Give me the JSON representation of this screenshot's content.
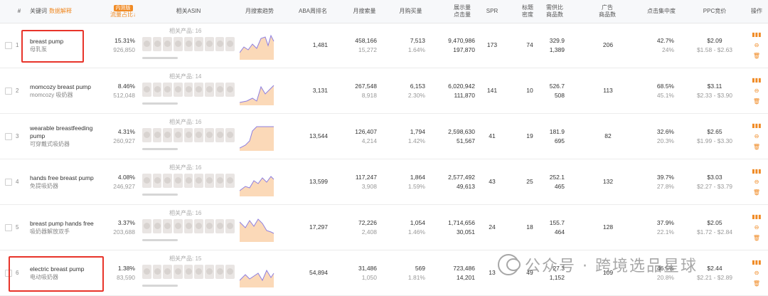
{
  "header": {
    "index": "#",
    "keyword": "关键词",
    "data_explain": "数据解释",
    "traffic_badge": "内测版",
    "traffic_share": "流量占比↓",
    "related_asin": "相关ASIN",
    "monthly_trend": "月搜索趋势",
    "aba_rank": "ABA周排名",
    "monthly_search": "月搜索量",
    "monthly_purchase": "月购买量",
    "display_click_1": "展示量",
    "display_click_2": "点击量",
    "spr": "SPR",
    "title_density_1": "标题",
    "title_density_2": "密度",
    "supply_ratio_1": "需供比",
    "supply_ratio_2": "商品数",
    "ad_products_1": "广告",
    "ad_products_2": "商品数",
    "click_concentration": "点击集中度",
    "ppc_bid": "PPC竞价",
    "actions": "操作"
  },
  "rows": [
    {
      "no": "1",
      "kw": "breast pump",
      "kw_cn": "母乳泵",
      "share": "15.31%",
      "share_sub": "926,850",
      "rel": "相关产品: 16",
      "aba": "1,481",
      "search": "458,166",
      "search_sub": "15,272",
      "purchase": "7,513",
      "purchase_sub": "1.64%",
      "display": "9,470,986",
      "click": "197,870",
      "spr": "173",
      "density": "74",
      "ratio": "329.9",
      "products": "1,389",
      "ads": "206",
      "conc": "42.7%",
      "conc_sub": "24%",
      "ppc": "$2.09",
      "ppc_range": "$1.58 - $2.63"
    },
    {
      "no": "2",
      "kw": "momcozy breast pump",
      "kw_cn": "momcozy 吸奶器",
      "share": "8.46%",
      "share_sub": "512,048",
      "rel": "相关产品: 14",
      "aba": "3,131",
      "search": "267,548",
      "search_sub": "8,918",
      "purchase": "6,153",
      "purchase_sub": "2.30%",
      "display": "6,020,942",
      "click": "111,870",
      "spr": "141",
      "density": "10",
      "ratio": "526.7",
      "products": "508",
      "ads": "113",
      "conc": "68.5%",
      "conc_sub": "45.1%",
      "ppc": "$3.11",
      "ppc_range": "$2.33 - $3.90"
    },
    {
      "no": "3",
      "kw": "wearable breastfeeding pump",
      "kw_cn": "可穿戴式吸奶器",
      "share": "4.31%",
      "share_sub": "260,927",
      "rel": "相关产品: 16",
      "aba": "13,544",
      "search": "126,407",
      "search_sub": "4,214",
      "purchase": "1,794",
      "purchase_sub": "1.42%",
      "display": "2,598,630",
      "click": "51,567",
      "spr": "41",
      "density": "19",
      "ratio": "181.9",
      "products": "695",
      "ads": "82",
      "conc": "32.6%",
      "conc_sub": "20.3%",
      "ppc": "$2.65",
      "ppc_range": "$1.99 - $3.30"
    },
    {
      "no": "4",
      "kw": "hands free breast pump",
      "kw_cn": "免提吸奶器",
      "share": "4.08%",
      "share_sub": "246,927",
      "rel": "相关产品: 16",
      "aba": "13,599",
      "search": "117,247",
      "search_sub": "3,908",
      "purchase": "1,864",
      "purchase_sub": "1.59%",
      "display": "2,577,492",
      "click": "49,613",
      "spr": "43",
      "density": "25",
      "ratio": "252.1",
      "products": "465",
      "ads": "132",
      "conc": "39.7%",
      "conc_sub": "27.8%",
      "ppc": "$3.03",
      "ppc_range": "$2.27 - $3.79"
    },
    {
      "no": "5",
      "kw": "breast pump hands free",
      "kw_cn": "吸奶器解放双手",
      "share": "3.37%",
      "share_sub": "203,688",
      "rel": "相关产品: 16",
      "aba": "17,297",
      "search": "72,226",
      "search_sub": "2,408",
      "purchase": "1,054",
      "purchase_sub": "1.46%",
      "display": "1,714,656",
      "click": "30,051",
      "spr": "24",
      "density": "18",
      "ratio": "155.7",
      "products": "464",
      "ads": "128",
      "conc": "37.9%",
      "conc_sub": "22.1%",
      "ppc": "$2.05",
      "ppc_range": "$1.72 - $2.84"
    },
    {
      "no": "6",
      "kw": "electric breast pump",
      "kw_cn": "电动吸奶器",
      "share": "1.38%",
      "share_sub": "83,590",
      "rel": "相关产品: 15",
      "aba": "54,894",
      "search": "31,486",
      "search_sub": "1,050",
      "purchase": "569",
      "purchase_sub": "1.81%",
      "display": "723,486",
      "click": "14,201",
      "spr": "13",
      "density": "49",
      "ratio": "27.3",
      "products": "1,152",
      "ads": "109",
      "conc": "46.5%",
      "conc_sub": "20.8%",
      "ppc": "$2.44",
      "ppc_range": "$2.21 - $2.89"
    }
  ],
  "icons": {
    "bar": "bar-chart-icon",
    "search": "search-circle-icon",
    "trash": "trash-icon"
  },
  "colors": {
    "accent": "#f08a24",
    "highlight": "#e8342a",
    "trend_line": "#8e7fe0",
    "trend_fill": "#fbd9b8"
  },
  "watermark": "公众号 · 跨境选品星球"
}
